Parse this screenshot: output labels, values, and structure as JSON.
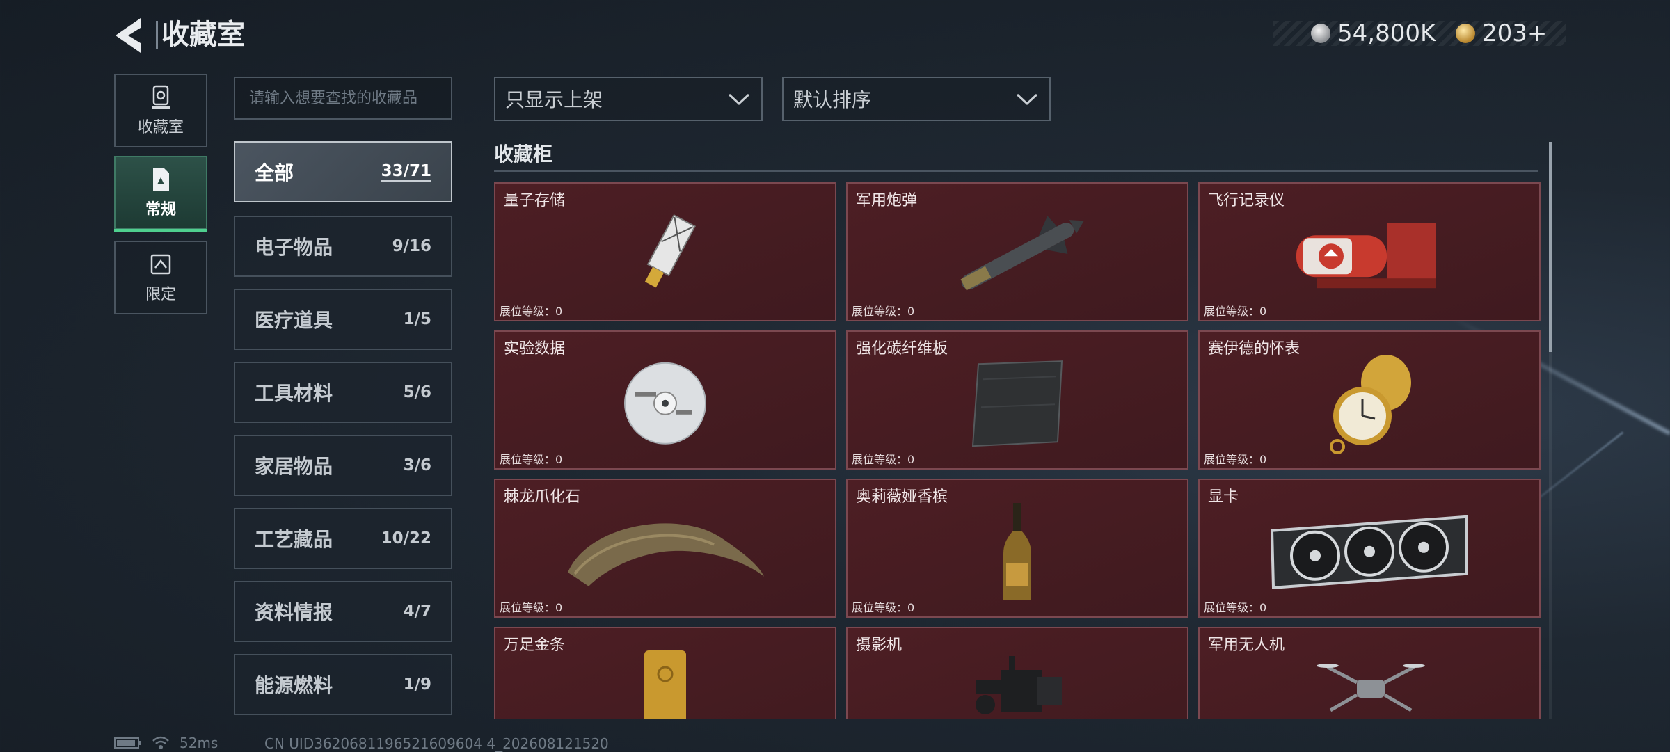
{
  "header": {
    "title": "收藏室",
    "currency": [
      {
        "icon": "silver-coin-icon",
        "value": "54,800K"
      },
      {
        "icon": "gold-coin-icon",
        "value": "203+"
      }
    ]
  },
  "rail": [
    {
      "label": "收藏室",
      "icon": "trophy-icon",
      "active": false
    },
    {
      "label": "常规",
      "icon": "document-icon",
      "active": true
    },
    {
      "label": "限定",
      "icon": "limited-icon",
      "active": false
    }
  ],
  "search": {
    "placeholder": "请输入想要查找的收藏品"
  },
  "categories": [
    {
      "name": "全部",
      "count": "33/71",
      "active": true
    },
    {
      "name": "电子物品",
      "count": "9/16"
    },
    {
      "name": "医疗道具",
      "count": "1/5"
    },
    {
      "name": "工具材料",
      "count": "5/6"
    },
    {
      "name": "家居物品",
      "count": "3/6"
    },
    {
      "name": "工艺藏品",
      "count": "10/22"
    },
    {
      "name": "资料情报",
      "count": "4/7"
    },
    {
      "name": "能源燃料",
      "count": "1/9"
    }
  ],
  "filters": {
    "display_filter": "只显示上架",
    "sort": "默认排序"
  },
  "section_title": "收藏柜",
  "level_prefix": "展位等级：",
  "items": [
    {
      "name": "量子存储",
      "level": "0",
      "icon": "usb-drive-icon"
    },
    {
      "name": "军用炮弹",
      "level": "0",
      "icon": "missile-icon"
    },
    {
      "name": "飞行记录仪",
      "level": "0",
      "icon": "flight-recorder-icon"
    },
    {
      "name": "实验数据",
      "level": "0",
      "icon": "disc-icon"
    },
    {
      "name": "强化碳纤维板",
      "level": "0",
      "icon": "carbon-plate-icon"
    },
    {
      "name": "赛伊德的怀表",
      "level": "0",
      "icon": "pocket-watch-icon"
    },
    {
      "name": "棘龙爪化石",
      "level": "0",
      "icon": "claw-fossil-icon"
    },
    {
      "name": "奥莉薇娅香槟",
      "level": "0",
      "icon": "champagne-icon"
    },
    {
      "name": "显卡",
      "level": "0",
      "icon": "graphics-card-icon"
    },
    {
      "name": "万足金条",
      "level": "",
      "icon": "gold-bar-icon"
    },
    {
      "name": "摄影机",
      "level": "",
      "icon": "camera-icon"
    },
    {
      "name": "军用无人机",
      "level": "",
      "icon": "drone-icon"
    }
  ],
  "status": {
    "ping": "52ms",
    "uid": "CN UID3620681196521609604 4_202608121520"
  },
  "colors": {
    "card_bg": "#45191e",
    "card_border": "#7b4850",
    "accent_green": "#4fd08f"
  }
}
